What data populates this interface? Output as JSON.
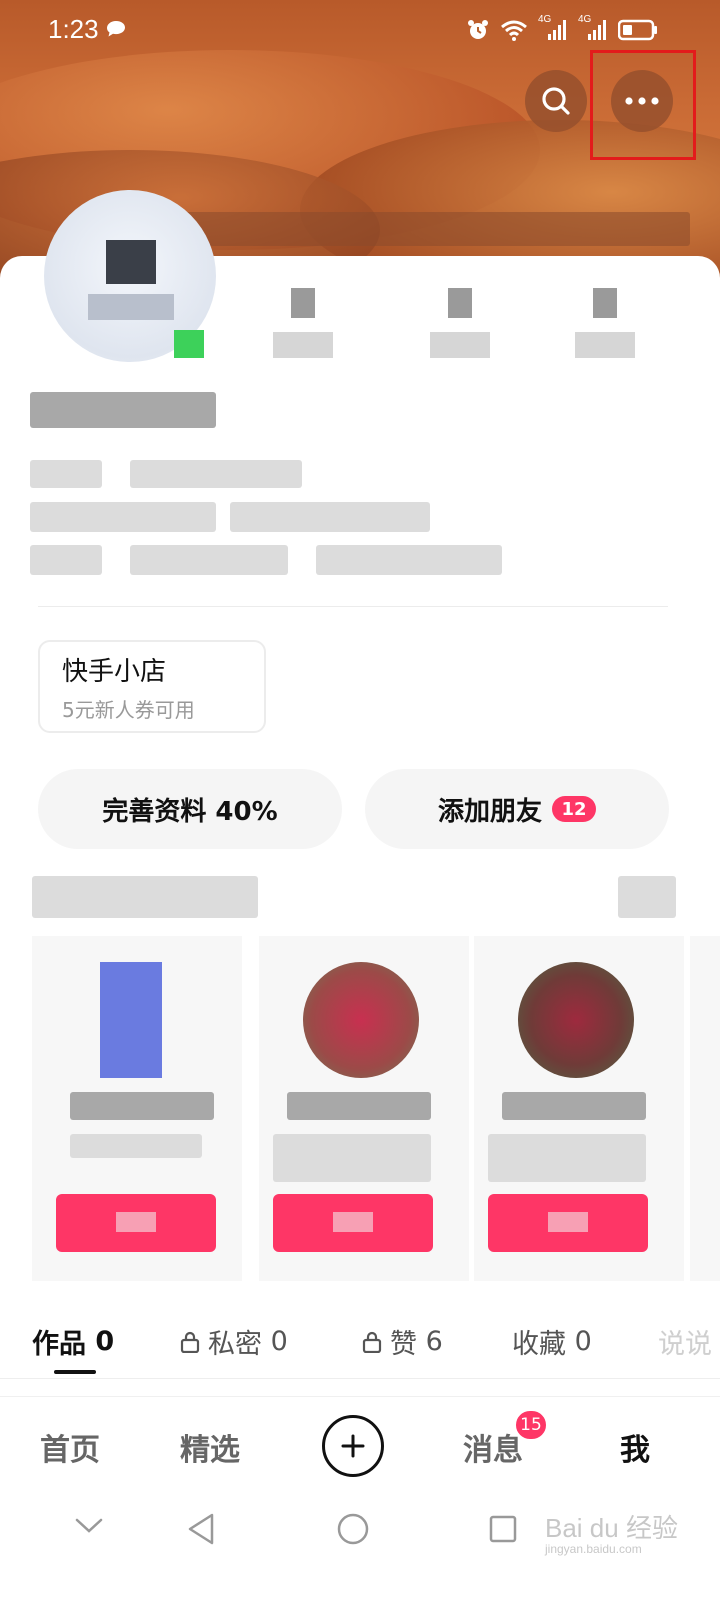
{
  "status_bar": {
    "time": "1:23",
    "network_1": "4G",
    "network_2": "4G"
  },
  "header": {
    "search_icon": "search-icon",
    "more_icon": "more-horizontal-icon"
  },
  "shop": {
    "title": "快手小店",
    "subtitle": "5元新人券可用"
  },
  "actions": {
    "complete_profile": "完善资料 40%",
    "add_friends": "添加朋友",
    "add_friends_badge": "12"
  },
  "tabs": [
    {
      "label": "作品",
      "count": "0",
      "locked": false,
      "active": true
    },
    {
      "label": "私密",
      "count": "0",
      "locked": true,
      "active": false
    },
    {
      "label": "赞",
      "count": "6",
      "locked": true,
      "active": false
    },
    {
      "label": "收藏",
      "count": "0",
      "locked": false,
      "active": false
    },
    {
      "label": "说说",
      "count": "",
      "locked": false,
      "active": false
    }
  ],
  "bottom_nav": {
    "home": "首页",
    "featured": "精选",
    "messages": "消息",
    "messages_badge": "15",
    "me": "我"
  },
  "watermark": {
    "text": "Bai du 经验",
    "sub": "jingyan.baidu.com"
  },
  "colors": {
    "accent": "#fe3666",
    "highlight_box": "#e31b1b",
    "banner": "#c96a35"
  }
}
